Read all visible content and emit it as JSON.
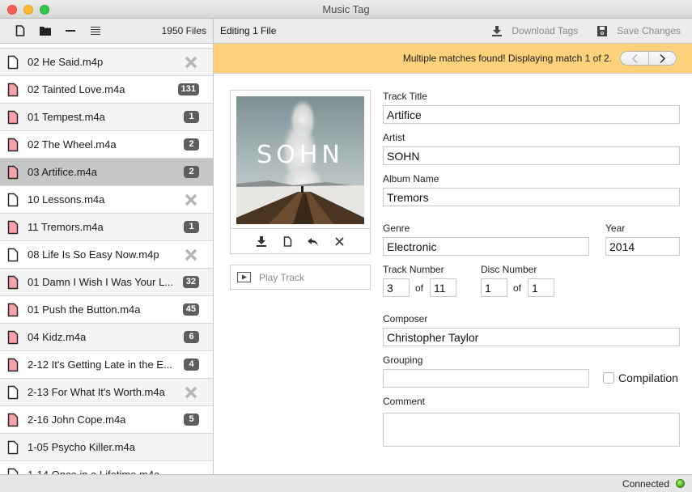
{
  "window": {
    "title": "Music Tag"
  },
  "toolbar": {
    "file_count": "1950 Files",
    "editing": "Editing 1 File",
    "download_tags": "Download Tags",
    "save_changes": "Save Changes"
  },
  "files": [
    {
      "name": "02 He Said.m4p",
      "matched": false,
      "status": "none"
    },
    {
      "name": "02 Tainted Love.m4a",
      "matched": true,
      "status": "131"
    },
    {
      "name": "01 Tempest.m4a",
      "matched": true,
      "status": "1"
    },
    {
      "name": "02 The Wheel.m4a",
      "matched": true,
      "status": "2"
    },
    {
      "name": "03 Artifice.m4a",
      "matched": true,
      "status": "2",
      "selected": true
    },
    {
      "name": "10 Lessons.m4a",
      "matched": false,
      "status": "none"
    },
    {
      "name": "11 Tremors.m4a",
      "matched": true,
      "status": "1"
    },
    {
      "name": "08 Life Is So Easy Now.m4p",
      "matched": false,
      "status": "none"
    },
    {
      "name": "01 Damn I Wish I Was Your L...",
      "matched": true,
      "status": "32"
    },
    {
      "name": "01 Push the Button.m4a",
      "matched": true,
      "status": "45"
    },
    {
      "name": "04 Kidz.m4a",
      "matched": true,
      "status": "6"
    },
    {
      "name": "2-12 It's Getting Late in the E...",
      "matched": true,
      "status": "4"
    },
    {
      "name": "2-13 For What It's Worth.m4a",
      "matched": false,
      "status": "none"
    },
    {
      "name": "2-16 John Cope.m4a",
      "matched": true,
      "status": "5"
    },
    {
      "name": "1-05 Psycho Killer.m4a",
      "matched": false,
      "status": ""
    },
    {
      "name": "1-14 Once in a Lifetime.m4a",
      "matched": false,
      "status": ""
    }
  ],
  "banner": {
    "message": "Multiple matches found! Displaying match 1 of 2.",
    "match_index": 1,
    "match_total": 2
  },
  "artwork": {
    "text": "SOHN"
  },
  "play": {
    "label": "Play Track"
  },
  "form": {
    "track_title_label": "Track Title",
    "track_title": "Artifice",
    "artist_label": "Artist",
    "artist": "SOHN",
    "album_label": "Album Name",
    "album": "Tremors",
    "genre_label": "Genre",
    "genre": "Electronic",
    "year_label": "Year",
    "year": "2014",
    "track_number_label": "Track Number",
    "track_number": "3",
    "track_total": "11",
    "disc_number_label": "Disc Number",
    "disc_number": "1",
    "disc_total": "1",
    "of_label": "of",
    "composer_label": "Composer",
    "composer": "Christopher Taylor",
    "grouping_label": "Grouping",
    "grouping": "",
    "compilation_label": "Compilation",
    "compilation": false,
    "comment_label": "Comment",
    "comment": ""
  },
  "status": {
    "text": "Connected",
    "color": "#4fb81b"
  },
  "colors": {
    "banner": "#fdd27a",
    "matched_file": "#f6a3ab",
    "badge": "#5d5d5d",
    "selected_row": "#c6c6c6"
  }
}
